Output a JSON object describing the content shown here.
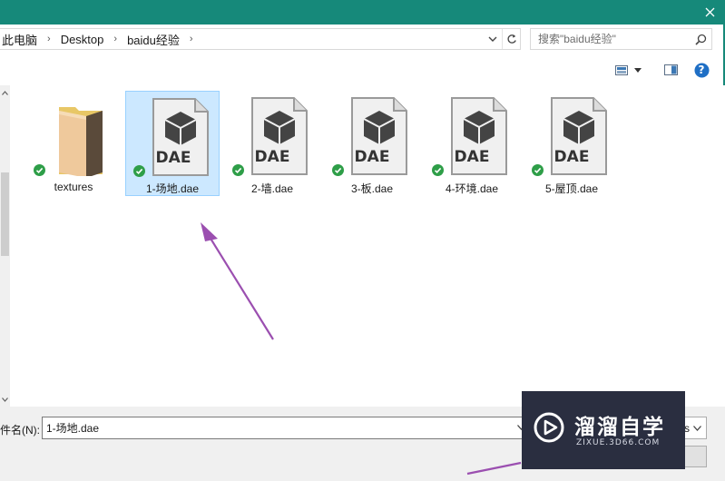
{
  "window": {
    "accent_color": "#16897a"
  },
  "addressbar": {
    "crumbs": [
      "此电脑",
      "Desktop",
      "baidu经验"
    ]
  },
  "search": {
    "placeholder": "搜索\"baidu经验\""
  },
  "toolbar": {
    "icons": [
      "view-mode-icon",
      "chevron-down-icon",
      "preview-pane-icon",
      "help-icon"
    ],
    "help_label": "?"
  },
  "files": [
    {
      "name": "textures",
      "type": "folder",
      "selected": false
    },
    {
      "name": "1-场地.dae",
      "type": "dae",
      "icon_label": "DAE",
      "selected": true
    },
    {
      "name": "2-墙.dae",
      "type": "dae",
      "icon_label": "DAE",
      "selected": false
    },
    {
      "name": "3-板.dae",
      "type": "dae",
      "icon_label": "DAE",
      "selected": false
    },
    {
      "name": "4-环境.dae",
      "type": "dae",
      "icon_label": "DAE",
      "selected": false
    },
    {
      "name": "5-屋顶.dae",
      "type": "dae",
      "icon_label": "DAE",
      "selected": false
    }
  ],
  "bottom": {
    "filename_label": "件名(N):",
    "filename_value": "1-场地.dae",
    "type_select_value": "s"
  },
  "watermark": {
    "title": "溜溜自学",
    "subtitle": "ZIXUE.3D66.COM",
    "bg_color": "#2a2e40"
  },
  "annotation": {
    "arrow_color": "#9b4fb0"
  }
}
